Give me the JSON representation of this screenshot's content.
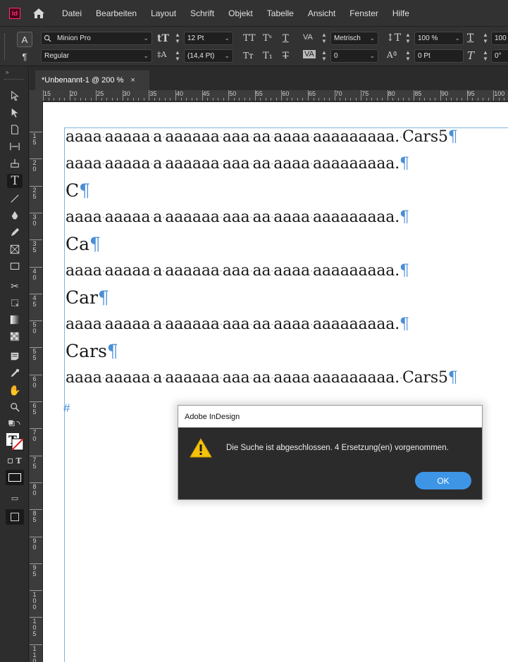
{
  "app": {
    "logo_text": "Id"
  },
  "menu": [
    "Datei",
    "Bearbeiten",
    "Layout",
    "Schrift",
    "Objekt",
    "Tabelle",
    "Ansicht",
    "Fenster",
    "Hilfe"
  ],
  "control_panel": {
    "mode_char": "A",
    "mode_para": "¶",
    "font_family": "Minion Pro",
    "font_style": "Regular",
    "font_size": "12 Pt",
    "leading": "(14,4 Pt)",
    "kerning": "Metrisch",
    "tracking": "0",
    "vertical_scale": "100 %",
    "baseline_shift": "0 Pt",
    "horizontal_scale": "100",
    "skew": "0°"
  },
  "tab": {
    "title": "*Unbenannt-1 @ 200 %",
    "close": "×"
  },
  "ruler_h": [
    "15",
    "20",
    "25",
    "30",
    "35",
    "40",
    "45",
    "50",
    "55",
    "60",
    "65",
    "70",
    "75",
    "80",
    "85",
    "90",
    "95",
    "100"
  ],
  "ruler_v": [
    "1\n5",
    "2\n0",
    "2\n5",
    "3\n0",
    "3\n5",
    "4\n0",
    "4\n5",
    "5\n0",
    "5\n5",
    "6\n0",
    "6\n5",
    "7\n0",
    "7\n5",
    "8\n0",
    "8\n5",
    "9\n0",
    "9\n5",
    "1\n0\n0",
    "1\n0\n5",
    "1\n1\n0"
  ],
  "document": {
    "lines": [
      {
        "text": "aaaa·aaaaa·a·aaaaaa·aaa·aa·aaaa·aaaaaaaaa.·Cars5",
        "mark": "¶",
        "size": "small"
      },
      {
        "text": "aaaa·aaaaa·a·aaaaaa·aaa·aa·aaaa·aaaaaaaaa.",
        "mark": "¶",
        "size": "small"
      },
      {
        "text": "C",
        "mark": "¶",
        "size": "big"
      },
      {
        "text": "aaaa·aaaaa·a·aaaaaa·aaa·aa·aaaa·aaaaaaaaa.",
        "mark": "¶",
        "size": "small"
      },
      {
        "text": "Ca",
        "mark": "¶",
        "size": "big"
      },
      {
        "text": "aaaa·aaaaa·a·aaaaaa·aaa·aa·aaaa·aaaaaaaaa.",
        "mark": "¶",
        "size": "small"
      },
      {
        "text": "Car",
        "mark": "¶",
        "size": "big"
      },
      {
        "text": "aaaa·aaaaa·a·aaaaaa·aaa·aa·aaaa·aaaaaaaaa.",
        "mark": "¶",
        "size": "small"
      },
      {
        "text": "Cars",
        "mark": "¶",
        "size": "big"
      },
      {
        "text": "aaaa·aaaaa·a·aaaaaa·aaa·aa·aaaa·aaaaaaaaa.·Cars5",
        "mark": "¶",
        "size": "small"
      }
    ],
    "end_mark": "#"
  },
  "dialog": {
    "title": "Adobe InDesign",
    "message": "Die Suche ist abgeschlossen. 4 Ersetzung(en) vorgenommen.",
    "ok_label": "OK"
  },
  "colors": {
    "accent": "#3e95e6",
    "pilcrow": "#4a8fd6",
    "frame_edge": "#7fb4dc"
  }
}
